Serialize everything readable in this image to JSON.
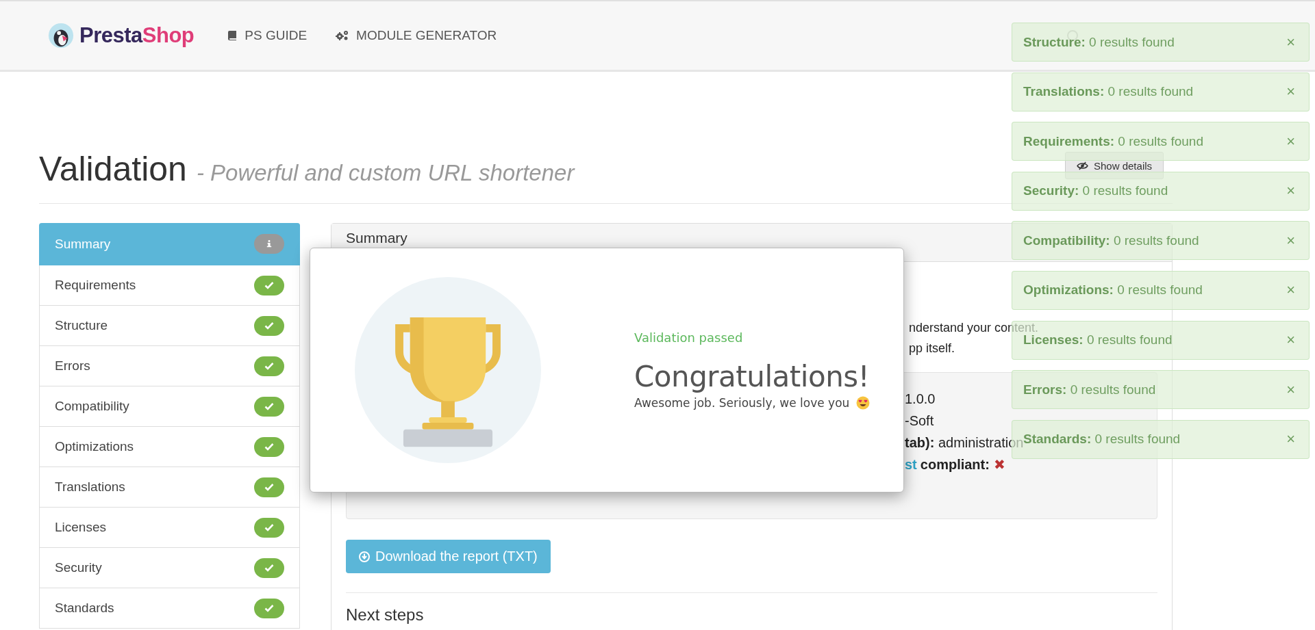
{
  "header": {
    "logo": [
      "Presta",
      "Shop"
    ],
    "nav": [
      {
        "label": "PS GUIDE"
      },
      {
        "label": "MODULE GENERATOR"
      }
    ]
  },
  "page": {
    "title": "Validation",
    "subtitle": "- Powerful and custom URL shortener"
  },
  "sidebar": {
    "items": [
      {
        "label": "Summary",
        "selected": true,
        "kind": "info"
      },
      {
        "label": "Requirements",
        "selected": false,
        "kind": "check"
      },
      {
        "label": "Structure",
        "selected": false,
        "kind": "check"
      },
      {
        "label": "Errors",
        "selected": false,
        "kind": "check"
      },
      {
        "label": "Compatibility",
        "selected": false,
        "kind": "check"
      },
      {
        "label": "Optimizations",
        "selected": false,
        "kind": "check"
      },
      {
        "label": "Translations",
        "selected": false,
        "kind": "check"
      },
      {
        "label": "Licenses",
        "selected": false,
        "kind": "check"
      },
      {
        "label": "Security",
        "selected": false,
        "kind": "check"
      },
      {
        "label": "Standards",
        "selected": false,
        "kind": "check"
      }
    ]
  },
  "panel": {
    "title": "Summary",
    "show_details": "Show details",
    "intro": [
      "nderstand your content.",
      "pp itself."
    ],
    "details": [
      {
        "text": "1.0.0"
      },
      {
        "text": "-Soft"
      },
      {
        "text": "**tab):** administration"
      },
      {
        "link": "st",
        "text": "**compliant:**",
        "mark": "✖"
      }
    ],
    "download": "Download the report (TXT)",
    "next_steps": "Next steps"
  },
  "modal": {
    "status": "Validation passed",
    "heading": "Congratulations!",
    "message": "Awesome job. Seriously, we love you"
  },
  "toasts": [
    {
      "title": "Structure:",
      "text": "0 results found",
      "close": "×"
    },
    {
      "title": "Translations:",
      "text": "0 results found",
      "close": "×"
    },
    {
      "title": "Requirements:",
      "text": "0 results found",
      "close": "×"
    },
    {
      "title": "Security:",
      "text": "0 results found",
      "close": "×"
    },
    {
      "title": "Compatibility:",
      "text": "0 results found",
      "close": "×"
    },
    {
      "title": "Optimizations:",
      "text": "0 results found",
      "close": "×"
    },
    {
      "title": "Licenses:",
      "text": "0 results found",
      "close": "×"
    },
    {
      "title": "Errors:",
      "text": "0 results found",
      "close": "×"
    },
    {
      "title": "Standards:",
      "text": "0 results found",
      "close": "×"
    }
  ]
}
